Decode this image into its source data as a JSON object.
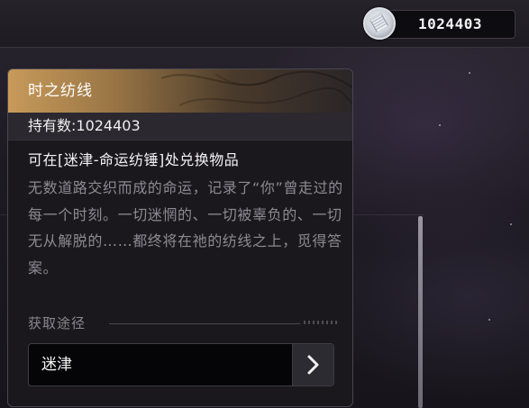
{
  "currency": {
    "icon": "spool-icon",
    "value": "1024403"
  },
  "item": {
    "title": "时之纺线",
    "count_text": "持有数:1024403",
    "exchange_text": "可在[迷津-命运纺锤]处兑换物品",
    "description": "无数道路交织而成的命运，记录了“你”曾走过的每一个时刻。一切迷惘的、一切被辜负的、一切无从解脱的……都终将在祂的纺线之上，觅得答案。"
  },
  "source": {
    "label": "获取途径",
    "entries": [
      {
        "name": "迷津",
        "icon": "chevron-right-icon"
      }
    ]
  },
  "colors": {
    "header_gold": "#c89a5a",
    "panel_bg": "#1a181d",
    "desc_text": "#8d8a92"
  }
}
